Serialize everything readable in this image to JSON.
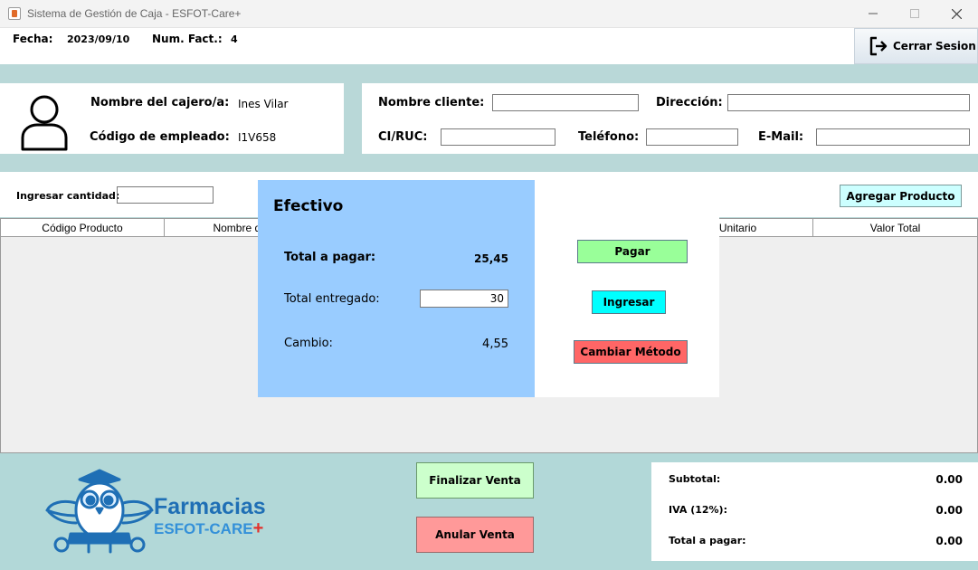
{
  "window": {
    "title": "Sistema de Gestión de Caja - ESFOT-Care+"
  },
  "header": {
    "fecha_label": "Fecha:",
    "fecha_value": "2023/09/10",
    "factura_label": "Num. Fact.:",
    "factura_value": "4",
    "logout_label": "Cerrar Sesion"
  },
  "cashier": {
    "name_label": "Nombre del cajero/a:",
    "name_value": "Ines Vilar",
    "code_label": "Código de empleado:",
    "code_value": "I1V658"
  },
  "client": {
    "name_label": "Nombre cliente:",
    "address_label": "Dirección:",
    "id_label": "CI/RUC:",
    "phone_label": "Teléfono:",
    "email_label": "E-Mail:"
  },
  "product_entry": {
    "qty_label": "Ingresar cantidad:",
    "add_button": "Agregar Producto"
  },
  "table": {
    "columns": [
      "Código Producto",
      "Nombre del p",
      "or Unitario",
      "Valor Total"
    ]
  },
  "actions": {
    "finalizar": "Finalizar Venta",
    "anular": "Anular Venta"
  },
  "totals": {
    "subtotal_label": "Subtotal:",
    "subtotal_value": "0.00",
    "iva_label": "IVA (12%):",
    "iva_value": "0.00",
    "total_label": "Total a pagar:",
    "total_value": "0.00"
  },
  "logo": {
    "line1": "Farmacias",
    "line2": "ESFOT-CARE",
    "plus": "+"
  },
  "payment_dialog": {
    "title": "Efectivo",
    "total_label": "Total a pagar:",
    "total_value": "25,45",
    "delivered_label": "Total entregado:",
    "delivered_value": "30",
    "change_label": "Cambio:",
    "change_value": "4,55",
    "pay_button": "Pagar",
    "enter_button": "Ingresar",
    "change_method_button": "Cambiar Método"
  },
  "colors": {
    "background": "#b9d8d8",
    "dialog_panel": "#99ccff",
    "pay_button": "#99ff99",
    "enter_button": "#00ffff",
    "change_method_button": "#ff6666",
    "add_product_button": "#ccffff",
    "finalize_button": "#ccffcc",
    "cancel_button": "#ff9999",
    "brand_blue": "#1f6fb5"
  }
}
